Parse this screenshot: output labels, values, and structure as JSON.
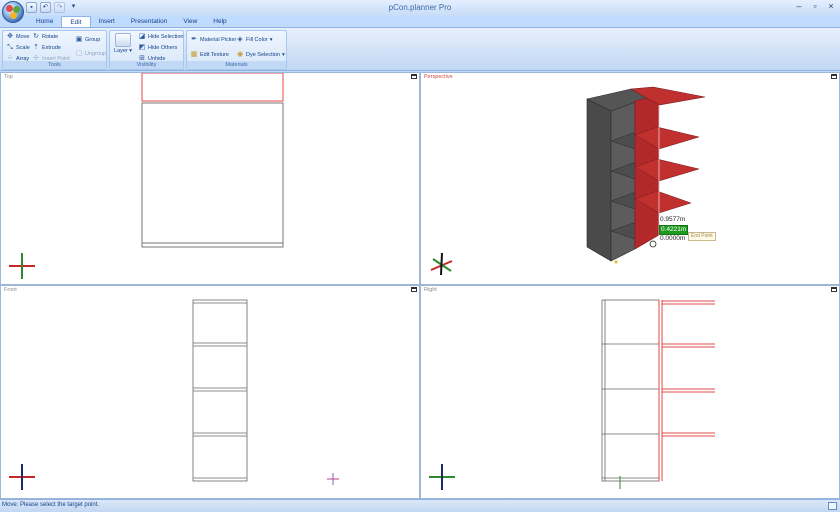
{
  "window": {
    "title": "pCon.planner Pro"
  },
  "quick_access": {
    "save_icon": "save-icon",
    "undo_icon": "undo-icon",
    "redo_icon": "redo-icon",
    "customize_glyph": "▾"
  },
  "tabs": [
    {
      "label": "Home"
    },
    {
      "label": "Edit"
    },
    {
      "label": "Insert"
    },
    {
      "label": "Presentation"
    },
    {
      "label": "View"
    },
    {
      "label": "Help"
    }
  ],
  "ribbon": {
    "tools": {
      "label": "Tools",
      "move": "Move",
      "rotate": "Rotate",
      "scale": "Scale",
      "extrude": "Extrude",
      "array": "Array",
      "insert_point": "Insert Point",
      "group": "Group",
      "ungroup": "Ungroup"
    },
    "visibility": {
      "label": "Visibility",
      "layer": "Layer",
      "hide_selection": "Hide Selection",
      "hide_others": "Hide Others",
      "unhide": "Unhide"
    },
    "materials": {
      "label": "Materials",
      "material_picker": "Material Picker",
      "fill_color": "Fill Color",
      "edit_texture": "Edit Texture",
      "dye_selection": "Dye Selection"
    }
  },
  "viewports": {
    "top": {
      "label": "Top"
    },
    "perspective": {
      "label": "Perspective",
      "readout_1": "0.9577m",
      "readout_2": "0.4221m",
      "readout_3": "0.0000m",
      "snap_hint": "End Point"
    },
    "front": {
      "label": "Front"
    },
    "right": {
      "label": "Right"
    }
  },
  "colors": {
    "accent_red": "#e24a4a",
    "shelf_red": "#b3292b",
    "shelf_dark": "#4a4a4a",
    "axis_green": "#2f8a2f",
    "axis_red": "#c62828",
    "axis_blue": "#1a2a6a",
    "readout_green": "#1f9a21"
  },
  "status": {
    "text": "Move: Please select the target point."
  }
}
